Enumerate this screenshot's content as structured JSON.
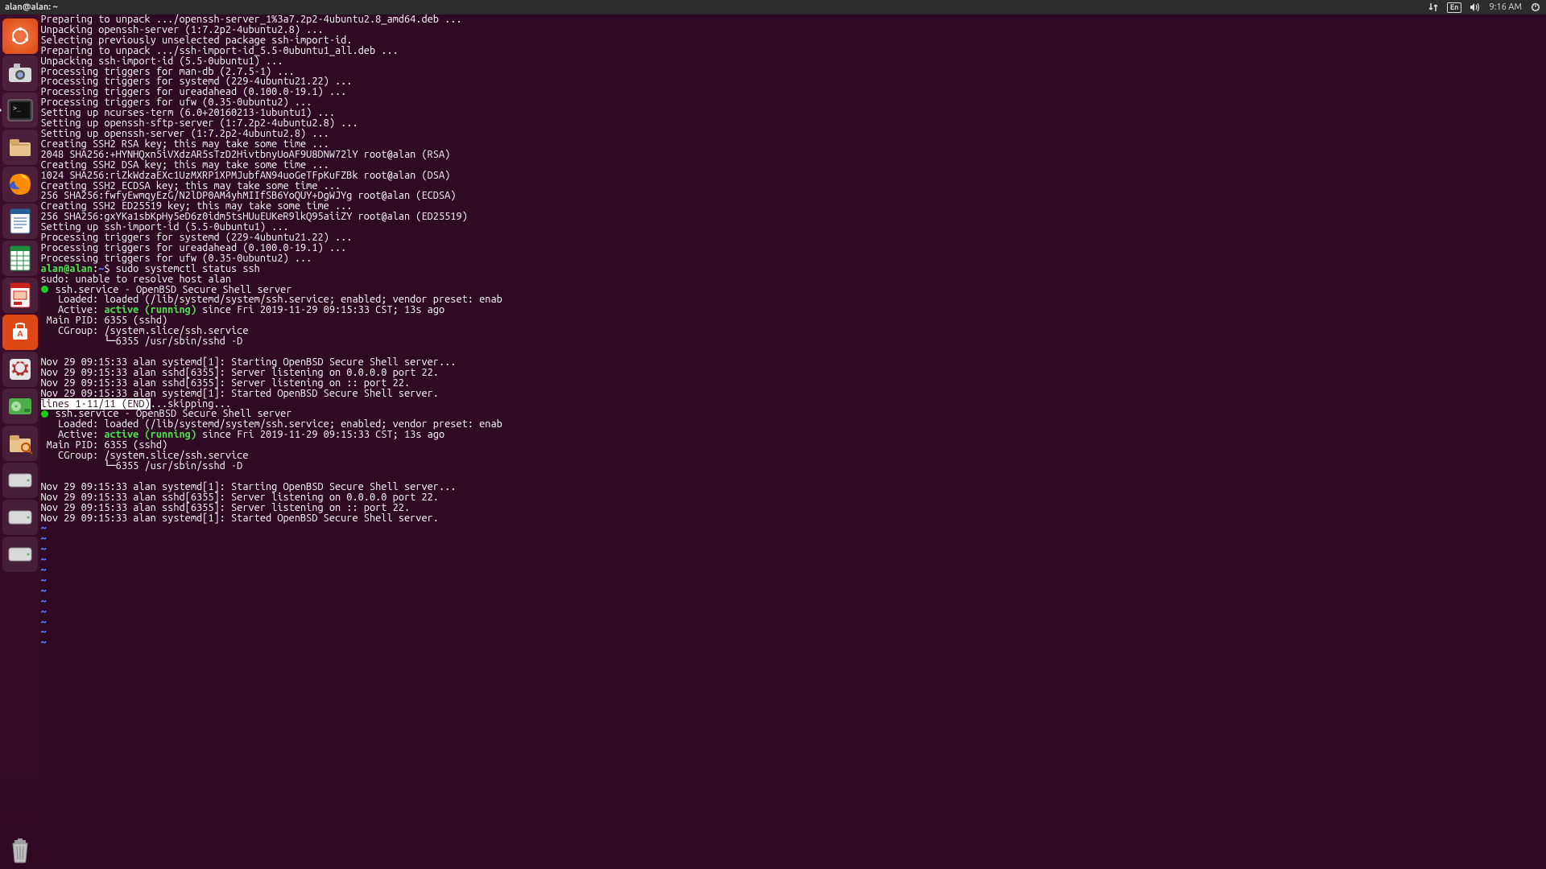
{
  "menubar": {
    "title": "alan@alan: ~",
    "lang": "En",
    "time": "9:16 AM"
  },
  "launcher": [
    {
      "name": "dash-icon",
      "label": "Dash"
    },
    {
      "name": "screenshot-icon",
      "label": "Screenshot"
    },
    {
      "name": "terminal-icon",
      "label": "Terminal",
      "active": true
    },
    {
      "name": "files-icon",
      "label": "Files"
    },
    {
      "name": "firefox-icon",
      "label": "Firefox"
    },
    {
      "name": "writer-icon",
      "label": "LibreOffice Writer"
    },
    {
      "name": "calc-icon",
      "label": "LibreOffice Calc"
    },
    {
      "name": "impress-icon",
      "label": "LibreOffice Impress"
    },
    {
      "name": "software-icon",
      "label": "Ubuntu Software"
    },
    {
      "name": "settings-icon",
      "label": "Settings"
    },
    {
      "name": "disks-icon",
      "label": "Disks"
    },
    {
      "name": "diskutil-icon",
      "label": "Disk Utility"
    },
    {
      "name": "drive1-icon",
      "label": "Drive"
    },
    {
      "name": "drive2-icon",
      "label": "Drive"
    },
    {
      "name": "drive3-icon",
      "label": "Drive"
    }
  ],
  "trash_label": "Trash",
  "terminal": {
    "lines": [
      {
        "t": "Preparing to unpack .../openssh-server_1%3a7.2p2-4ubuntu2.8_amd64.deb ..."
      },
      {
        "t": "Unpacking openssh-server (1:7.2p2-4ubuntu2.8) ..."
      },
      {
        "t": "Selecting previously unselected package ssh-import-id."
      },
      {
        "t": "Preparing to unpack .../ssh-import-id_5.5-0ubuntu1_all.deb ..."
      },
      {
        "t": "Unpacking ssh-import-id (5.5-0ubuntu1) ..."
      },
      {
        "t": "Processing triggers for man-db (2.7.5-1) ..."
      },
      {
        "t": "Processing triggers for systemd (229-4ubuntu21.22) ..."
      },
      {
        "t": "Processing triggers for ureadahead (0.100.0-19.1) ..."
      },
      {
        "t": "Processing triggers for ufw (0.35-0ubuntu2) ..."
      },
      {
        "t": "Setting up ncurses-term (6.0+20160213-1ubuntu1) ..."
      },
      {
        "t": "Setting up openssh-sftp-server (1:7.2p2-4ubuntu2.8) ..."
      },
      {
        "t": "Setting up openssh-server (1:7.2p2-4ubuntu2.8) ..."
      },
      {
        "t": "Creating SSH2 RSA key; this may take some time ..."
      },
      {
        "t": "2048 SHA256:+HYNHQxn5iVXdzAR5sTzD2HivtbnyUoAF9U8DNW72lY root@alan (RSA)"
      },
      {
        "t": "Creating SSH2 DSA key; this may take some time ..."
      },
      {
        "t": "1024 SHA256:riZkWdzaEXc1UzMXRP1XPMJubfAN94uoGeTFpKuFZBk root@alan (DSA)"
      },
      {
        "t": "Creating SSH2 ECDSA key; this may take some time ..."
      },
      {
        "t": "256 SHA256:fwfyEwmqyEzG/N2lDP0AM4yhMIIfSB6YoQUY+DgWJYg root@alan (ECDSA)"
      },
      {
        "t": "Creating SSH2 ED25519 key; this may take some time ..."
      },
      {
        "t": "256 SHA256:gxYKa1sbKpHy5eD6z0idm5tsHUuEUKeR9lkQ95aiiZY root@alan (ED25519)"
      },
      {
        "t": "Setting up ssh-import-id (5.5-0ubuntu1) ..."
      },
      {
        "t": "Processing triggers for systemd (229-4ubuntu21.22) ..."
      },
      {
        "t": "Processing triggers for ureadahead (0.100.0-19.1) ..."
      },
      {
        "t": "Processing triggers for ufw (0.35-0ubuntu2) ..."
      }
    ],
    "prompt_user": "alan@alan",
    "prompt_path": "~",
    "prompt_sep": ":",
    "prompt_char": "$ ",
    "cmd": "sudo systemctl status ssh",
    "sudo_line": "sudo: unable to resolve host alan",
    "svc_header": "ssh.service - OpenBSD Secure Shell server",
    "svc_loaded": "   Loaded: loaded (/lib/systemd/system/ssh.service; enabled; vendor preset: enab",
    "svc_active_pre": "   Active: ",
    "svc_active_state": "active (running)",
    "svc_active_post": " since Fri 2019-11-29 09:15:33 CST; 13s ago",
    "svc_main_pid": " Main PID: 6355 (sshd)",
    "svc_cgroup": "   CGroup: /system.slice/ssh.service",
    "svc_cgroup2": "           └─6355 /usr/sbin/sshd -D",
    "log1": "Nov 29 09:15:33 alan systemd[1]: Starting OpenBSD Secure Shell server...",
    "log2": "Nov 29 09:15:33 alan sshd[6355]: Server listening on 0.0.0.0 port 22.",
    "log3": "Nov 29 09:15:33 alan sshd[6355]: Server listening on :: port 22.",
    "log4": "Nov 29 09:15:33 alan systemd[1]: Started OpenBSD Secure Shell server.",
    "pager_status": "lines 1-11/11 (END)",
    "pager_skip": "...skipping...",
    "tilde": "~"
  }
}
